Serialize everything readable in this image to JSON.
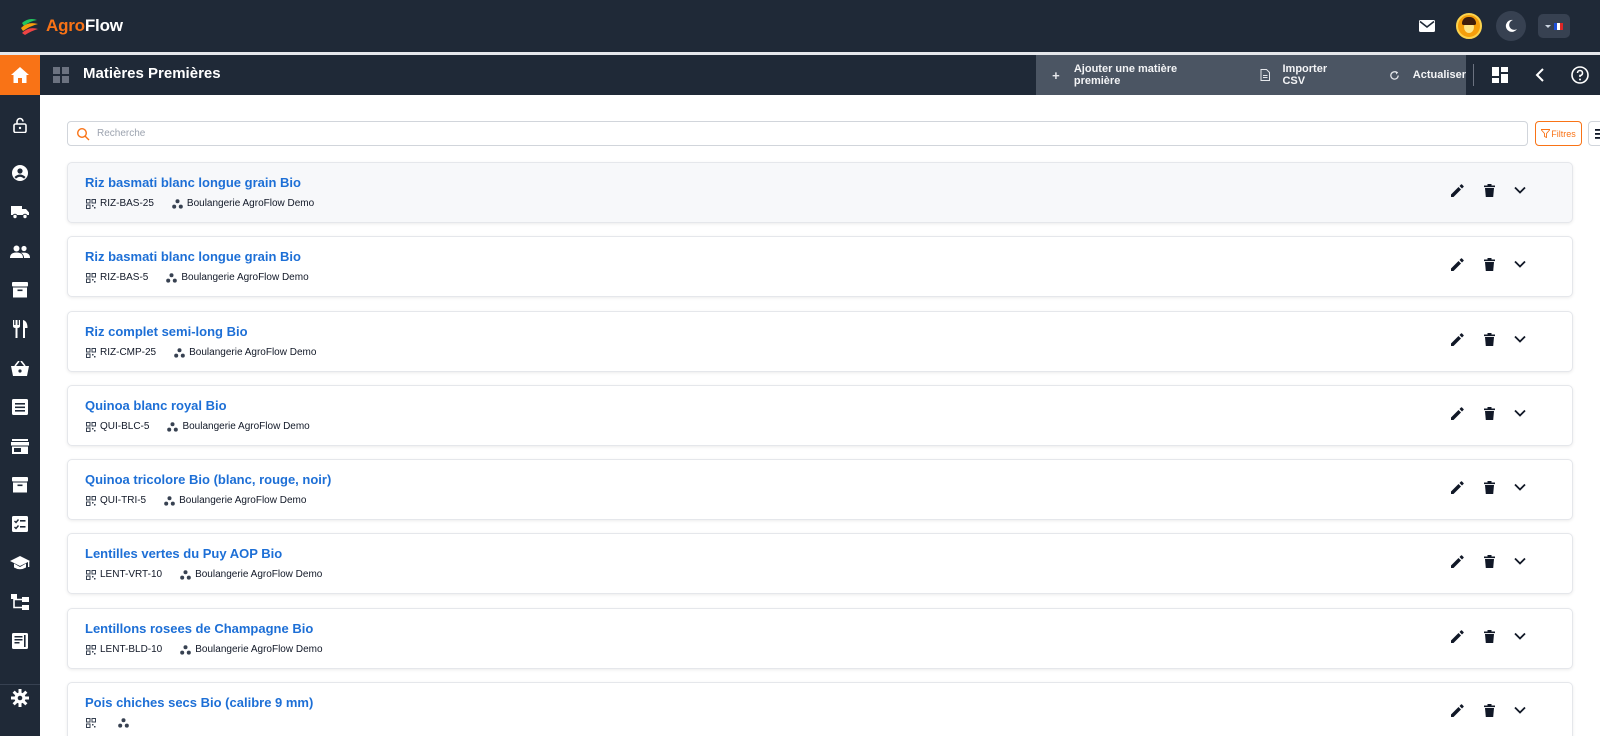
{
  "app": {
    "brand_part1": "Agro",
    "brand_part2": "Flow"
  },
  "topbar": {
    "icons": [
      "mail-icon",
      "user-avatar",
      "moon-icon",
      "language-selector"
    ],
    "language_flag": "fr"
  },
  "header": {
    "title": "Matières Premières",
    "actions": [
      {
        "label": "Ajouter une matière première",
        "icon": "plus-icon"
      },
      {
        "label": "Importer CSV",
        "icon": "file-icon"
      },
      {
        "label": "Actualiser",
        "icon": "refresh-icon"
      }
    ],
    "right_icons": [
      "dashboard-icon",
      "chevron-left-icon",
      "help-icon"
    ]
  },
  "sidebar": {
    "items": [
      "home-icon",
      "lock-icon",
      "account-icon",
      "truck-icon",
      "people-icon",
      "archive-icon",
      "restaurant-icon",
      "basket-icon",
      "list-icon",
      "store-icon",
      "inventory-icon",
      "checklist-icon",
      "school-icon",
      "hierarchy-icon",
      "book-icon",
      "settings-icon"
    ]
  },
  "search": {
    "placeholder": "Recherche",
    "value": ""
  },
  "filters": {
    "label": "Filtres"
  },
  "items": [
    {
      "name": "Riz basmati blanc longue grain Bio",
      "code": "RIZ-BAS-25",
      "org": "Boulangerie AgroFlow Demo"
    },
    {
      "name": "Riz basmati blanc longue grain Bio",
      "code": "RIZ-BAS-5",
      "org": "Boulangerie AgroFlow Demo"
    },
    {
      "name": "Riz complet semi-long Bio",
      "code": "RIZ-CMP-25",
      "org": "Boulangerie AgroFlow Demo"
    },
    {
      "name": "Quinoa blanc royal Bio",
      "code": "QUI-BLC-5",
      "org": "Boulangerie AgroFlow Demo"
    },
    {
      "name": "Quinoa tricolore Bio (blanc, rouge, noir)",
      "code": "QUI-TRI-5",
      "org": "Boulangerie AgroFlow Demo"
    },
    {
      "name": "Lentilles vertes du Puy AOP Bio",
      "code": "LENT-VRT-10",
      "org": "Boulangerie AgroFlow Demo"
    },
    {
      "name": "Lentillons rosees de Champagne Bio",
      "code": "LENT-BLD-10",
      "org": "Boulangerie AgroFlow Demo"
    },
    {
      "name": "Pois chiches secs Bio (calibre 9 mm)",
      "code": "",
      "org": ""
    }
  ],
  "colors": {
    "accent": "#f97316",
    "nav_bg": "#1f2937",
    "link": "#1d6fd6"
  }
}
